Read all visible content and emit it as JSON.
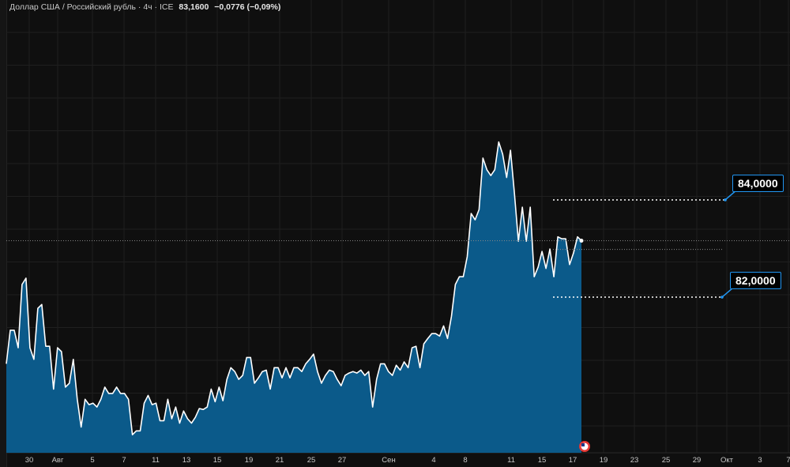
{
  "header": {
    "symbol": "Доллар США / Российский рубль · 4ч · ICE",
    "last": "83,1600",
    "change": "−0,0776 (−0,09%)"
  },
  "alerts": [
    {
      "label": "84,0000",
      "value": 84.0
    },
    {
      "label": "82,0000",
      "value": 82.0
    }
  ],
  "colors": {
    "line": "#ffffff",
    "fill": "#0b5a8a",
    "alert": "#2196f3",
    "bg": "#0f0f0f",
    "grid": "#1f1f1f"
  },
  "event_icon": "us-flag-icon",
  "chart_data": {
    "type": "area",
    "title": "Доллар США / Российский рубль · 4ч · ICE",
    "last_price": 83.16,
    "ylim": [
      78.8,
      88.11
    ],
    "grid": true,
    "x_ticks": [
      "30",
      "Авг",
      "5",
      "7",
      "11",
      "13",
      "15",
      "19",
      "21",
      "25",
      "27",
      "Сен",
      "4",
      "8",
      "11",
      "15",
      "17",
      "19",
      "23",
      "25",
      "29",
      "Окт",
      "3",
      "7"
    ],
    "values": [
      80.63,
      81.32,
      81.32,
      80.96,
      82.26,
      82.39,
      80.96,
      80.72,
      81.77,
      81.85,
      80.99,
      80.99,
      80.11,
      80.96,
      80.88,
      80.15,
      80.23,
      80.72,
      79.9,
      79.33,
      79.9,
      79.79,
      79.82,
      79.74,
      79.9,
      80.15,
      80.02,
      80.02,
      80.15,
      80.02,
      80.02,
      79.9,
      79.17,
      79.25,
      79.25,
      79.82,
      79.98,
      79.79,
      79.82,
      79.46,
      79.46,
      79.9,
      79.5,
      79.74,
      79.41,
      79.66,
      79.5,
      79.41,
      79.53,
      79.71,
      79.69,
      79.74,
      80.11,
      79.85,
      80.15,
      79.87,
      80.31,
      80.55,
      80.47,
      80.31,
      80.39,
      80.76,
      80.76,
      80.23,
      80.34,
      80.47,
      80.5,
      80.11,
      80.55,
      80.55,
      80.34,
      80.55,
      80.34,
      80.55,
      80.55,
      80.47,
      80.63,
      80.72,
      80.83,
      80.47,
      80.23,
      80.39,
      80.5,
      80.47,
      80.31,
      80.18,
      80.39,
      80.44,
      80.47,
      80.44,
      80.5,
      80.39,
      80.47,
      79.74,
      80.31,
      80.63,
      80.63,
      80.47,
      80.39,
      80.6,
      80.5,
      80.67,
      80.55,
      80.96,
      80.99,
      80.55,
      81.04,
      81.15,
      81.25,
      81.25,
      81.2,
      81.41,
      81.15,
      81.61,
      82.26,
      82.42,
      82.42,
      82.83,
      83.72,
      83.59,
      83.8,
      84.86,
      84.62,
      84.5,
      84.62,
      85.19,
      84.94,
      84.46,
      85.02,
      84.13,
      83.15,
      83.85,
      83.15,
      83.85,
      82.42,
      82.62,
      82.94,
      82.59,
      82.99,
      82.42,
      83.24,
      83.2,
      83.2,
      82.67,
      82.91,
      83.24,
      83.16
    ]
  }
}
